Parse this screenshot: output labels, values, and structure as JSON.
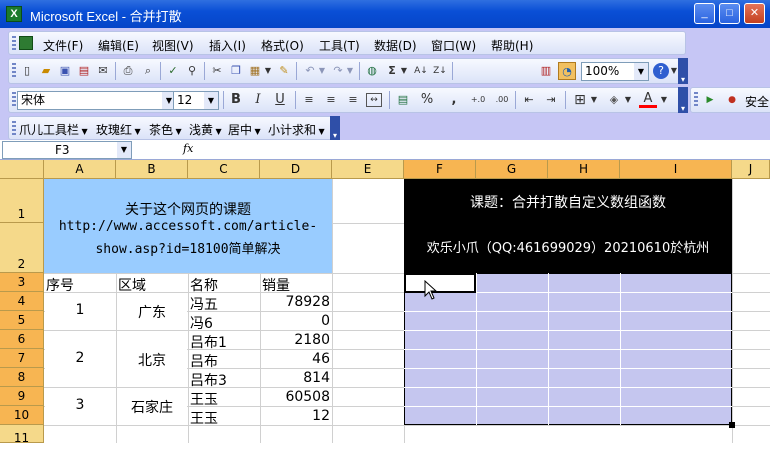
{
  "title": "Microsoft Excel - 合并打散",
  "menu": [
    "文件(F)",
    "编辑(E)",
    "视图(V)",
    "插入(I)",
    "格式(O)",
    "工具(T)",
    "数据(D)",
    "窗口(W)",
    "帮助(H)"
  ],
  "zoom": "100%",
  "font_name": "宋体",
  "font_size": "12",
  "formatting": {
    "bold": "B",
    "italic": "I",
    "underline": "U",
    "percent": "%",
    "comma": ",",
    "font_color_label": "A"
  },
  "security": "安全",
  "custom_toolbar": [
    "爪儿工具栏",
    "玫瑰红",
    "茶色",
    "浅黄",
    "居中",
    "小计求和"
  ],
  "name_box": "F3",
  "fx": "fx",
  "columns": [
    "A",
    "B",
    "C",
    "D",
    "E",
    "F",
    "G",
    "H",
    "I",
    "J"
  ],
  "rows": [
    "1",
    "2",
    "3",
    "4",
    "5",
    "6",
    "7",
    "8",
    "9",
    "10",
    "11"
  ],
  "info": {
    "line1": "关于这个网页的课题",
    "line2": "http://www.accessoft.com/article-",
    "line3": "show.asp?id=18100简单解决"
  },
  "banner": {
    "line1": "课题：合并打散自定义数组函数",
    "line2": "欢乐小爪（QQ:461699029）20210610於杭州"
  },
  "headers": {
    "seq": "序号",
    "region": "区域",
    "name": "名称",
    "sales": "销量"
  },
  "groups": [
    {
      "seq": "1",
      "region": "广东"
    },
    {
      "seq": "2",
      "region": "北京"
    },
    {
      "seq": "3",
      "region": "石家庄"
    }
  ],
  "records": [
    {
      "name": "冯五",
      "sales": "78928"
    },
    {
      "name": "冯6",
      "sales": "0"
    },
    {
      "name": "吕布1",
      "sales": "2180"
    },
    {
      "name": "吕布",
      "sales": "46"
    },
    {
      "name": "吕布3",
      "sales": "814"
    },
    {
      "name": "王玉",
      "sales": "60508"
    },
    {
      "name": "王玉",
      "sales": "12"
    }
  ],
  "colors": {
    "title_bar": "#0a4fd6",
    "selection_fill": "#c5c6ef",
    "info_fill": "#99ccff",
    "banner_fill": "#000000",
    "header_fill": "#f5d98a"
  }
}
